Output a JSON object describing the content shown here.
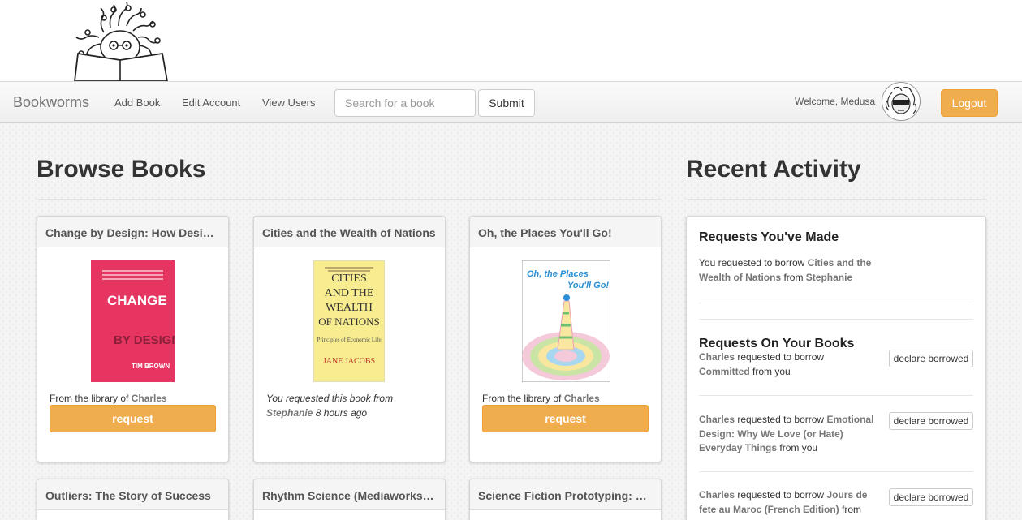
{
  "nav": {
    "brand": "Bookworms",
    "links": [
      "Add Book",
      "Edit Account",
      "View Users"
    ],
    "search_placeholder": "Search for a book",
    "submit_label": "Submit",
    "welcome": "Welcome, Medusa",
    "logout_label": "Logout"
  },
  "browse": {
    "heading": "Browse Books",
    "books": [
      {
        "title": "Change by Design: How Design Thinking Transforms Organizations and Inspires Innovation",
        "meta_prefix": "From the library of ",
        "owner": "Charles",
        "button": "request",
        "cover": {
          "bg": "#e63561",
          "line1": "CHANGE",
          "line2": "BY DESIGN",
          "author": "TIM BROWN"
        }
      },
      {
        "title": "Cities and the Wealth of Nations",
        "meta_line1": "You requested this book from",
        "owner": "Stephanie",
        "meta_time": "8 hours ago",
        "cover": {
          "bg": "#f7ec8f",
          "line1": "CITIES",
          "line2": "AND THE",
          "line3": "WEALTH",
          "line4": "OF NATIONS",
          "sub": "Principles of Economic Life",
          "author": "JANE JACOBS"
        }
      },
      {
        "title": "Oh, the Places You'll Go!",
        "meta_prefix": "From the library of ",
        "owner": "Charles",
        "button": "request",
        "cover": {
          "bg": "#ffffff",
          "line1": "Oh, the Places",
          "line2": "You'll Go!"
        }
      },
      {
        "title": "Outliers: The Story of Success"
      },
      {
        "title": "Rhythm Science (Mediaworks Pamphlets)"
      },
      {
        "title": "Science Fiction Prototyping: Designing the Future with Science Fiction"
      }
    ]
  },
  "activity": {
    "heading": "Recent Activity",
    "made": {
      "heading": "Requests You've Made",
      "pre": "You requested to borrow ",
      "book": "Cities and the Wealth of Nations",
      "mid": " from ",
      "owner": "Stephanie"
    },
    "on_yours": {
      "heading": "Requests On Your Books",
      "items": [
        {
          "user": "Charles",
          "verb": " requested to borrow ",
          "book": "Committed",
          "tail": " from you",
          "button": "declare borrowed"
        },
        {
          "user": "Charles",
          "verb": " requested to borrow ",
          "book": "Emotional Design: Why We Love (or Hate) Everyday Things",
          "tail": " from you",
          "button": "declare borrowed"
        },
        {
          "user": "Charles",
          "verb": " requested to borrow ",
          "book": "Jours de fete au Maroc (French Edition)",
          "tail": " from",
          "button": "declare borrowed"
        }
      ]
    }
  },
  "colors": {
    "accent": "#f0ad4e",
    "link_gray": "#777777"
  }
}
